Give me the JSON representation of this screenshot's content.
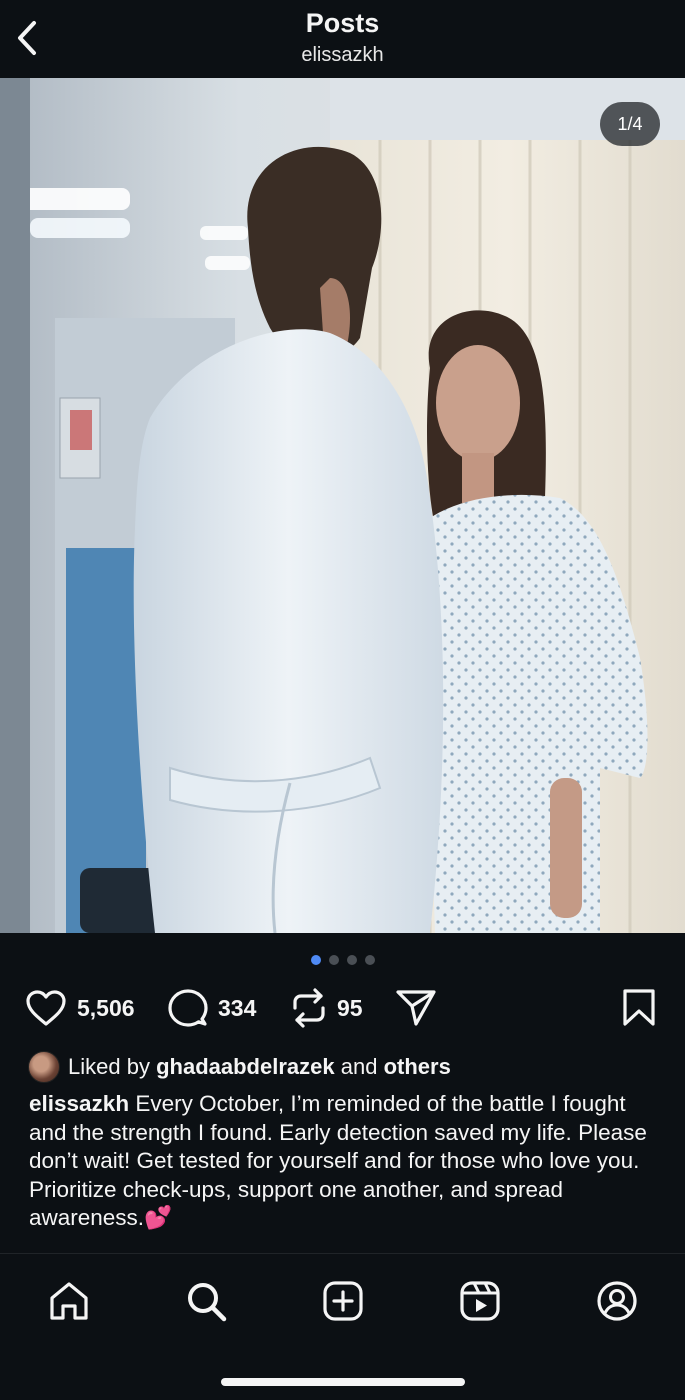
{
  "header": {
    "title": "Posts",
    "username": "elissazkh"
  },
  "post": {
    "image_counter": "1/4",
    "carousel": {
      "total": 4,
      "active_index": 0
    },
    "stats": {
      "likes": "5,506",
      "comments": "334",
      "reposts": "95"
    },
    "liked_by": {
      "prefix": "Liked by",
      "user": "ghadaabdelrazek",
      "connector": "and",
      "others": "others"
    },
    "caption": {
      "author": "elissazkh",
      "text": "Every October, I’m reminded of the battle I fought and the strength I found. Early detection saved my life. Please don’t wait! Get tested for yourself and for those who love you. Prioritize check-ups, support one another, and spread awareness.💕"
    }
  },
  "icons": {
    "back": "chevron-left-icon",
    "like": "heart-icon",
    "comment": "comment-icon",
    "repost": "repost-icon",
    "share": "send-icon",
    "save": "bookmark-icon",
    "tabs": [
      "home-icon",
      "search-icon",
      "create-icon",
      "reels-icon",
      "profile-icon"
    ]
  },
  "colors": {
    "background": "#0c1014",
    "text": "#f5f5f5",
    "active_dot": "#4f8af5",
    "inactive_dot": "#4a4f55"
  }
}
